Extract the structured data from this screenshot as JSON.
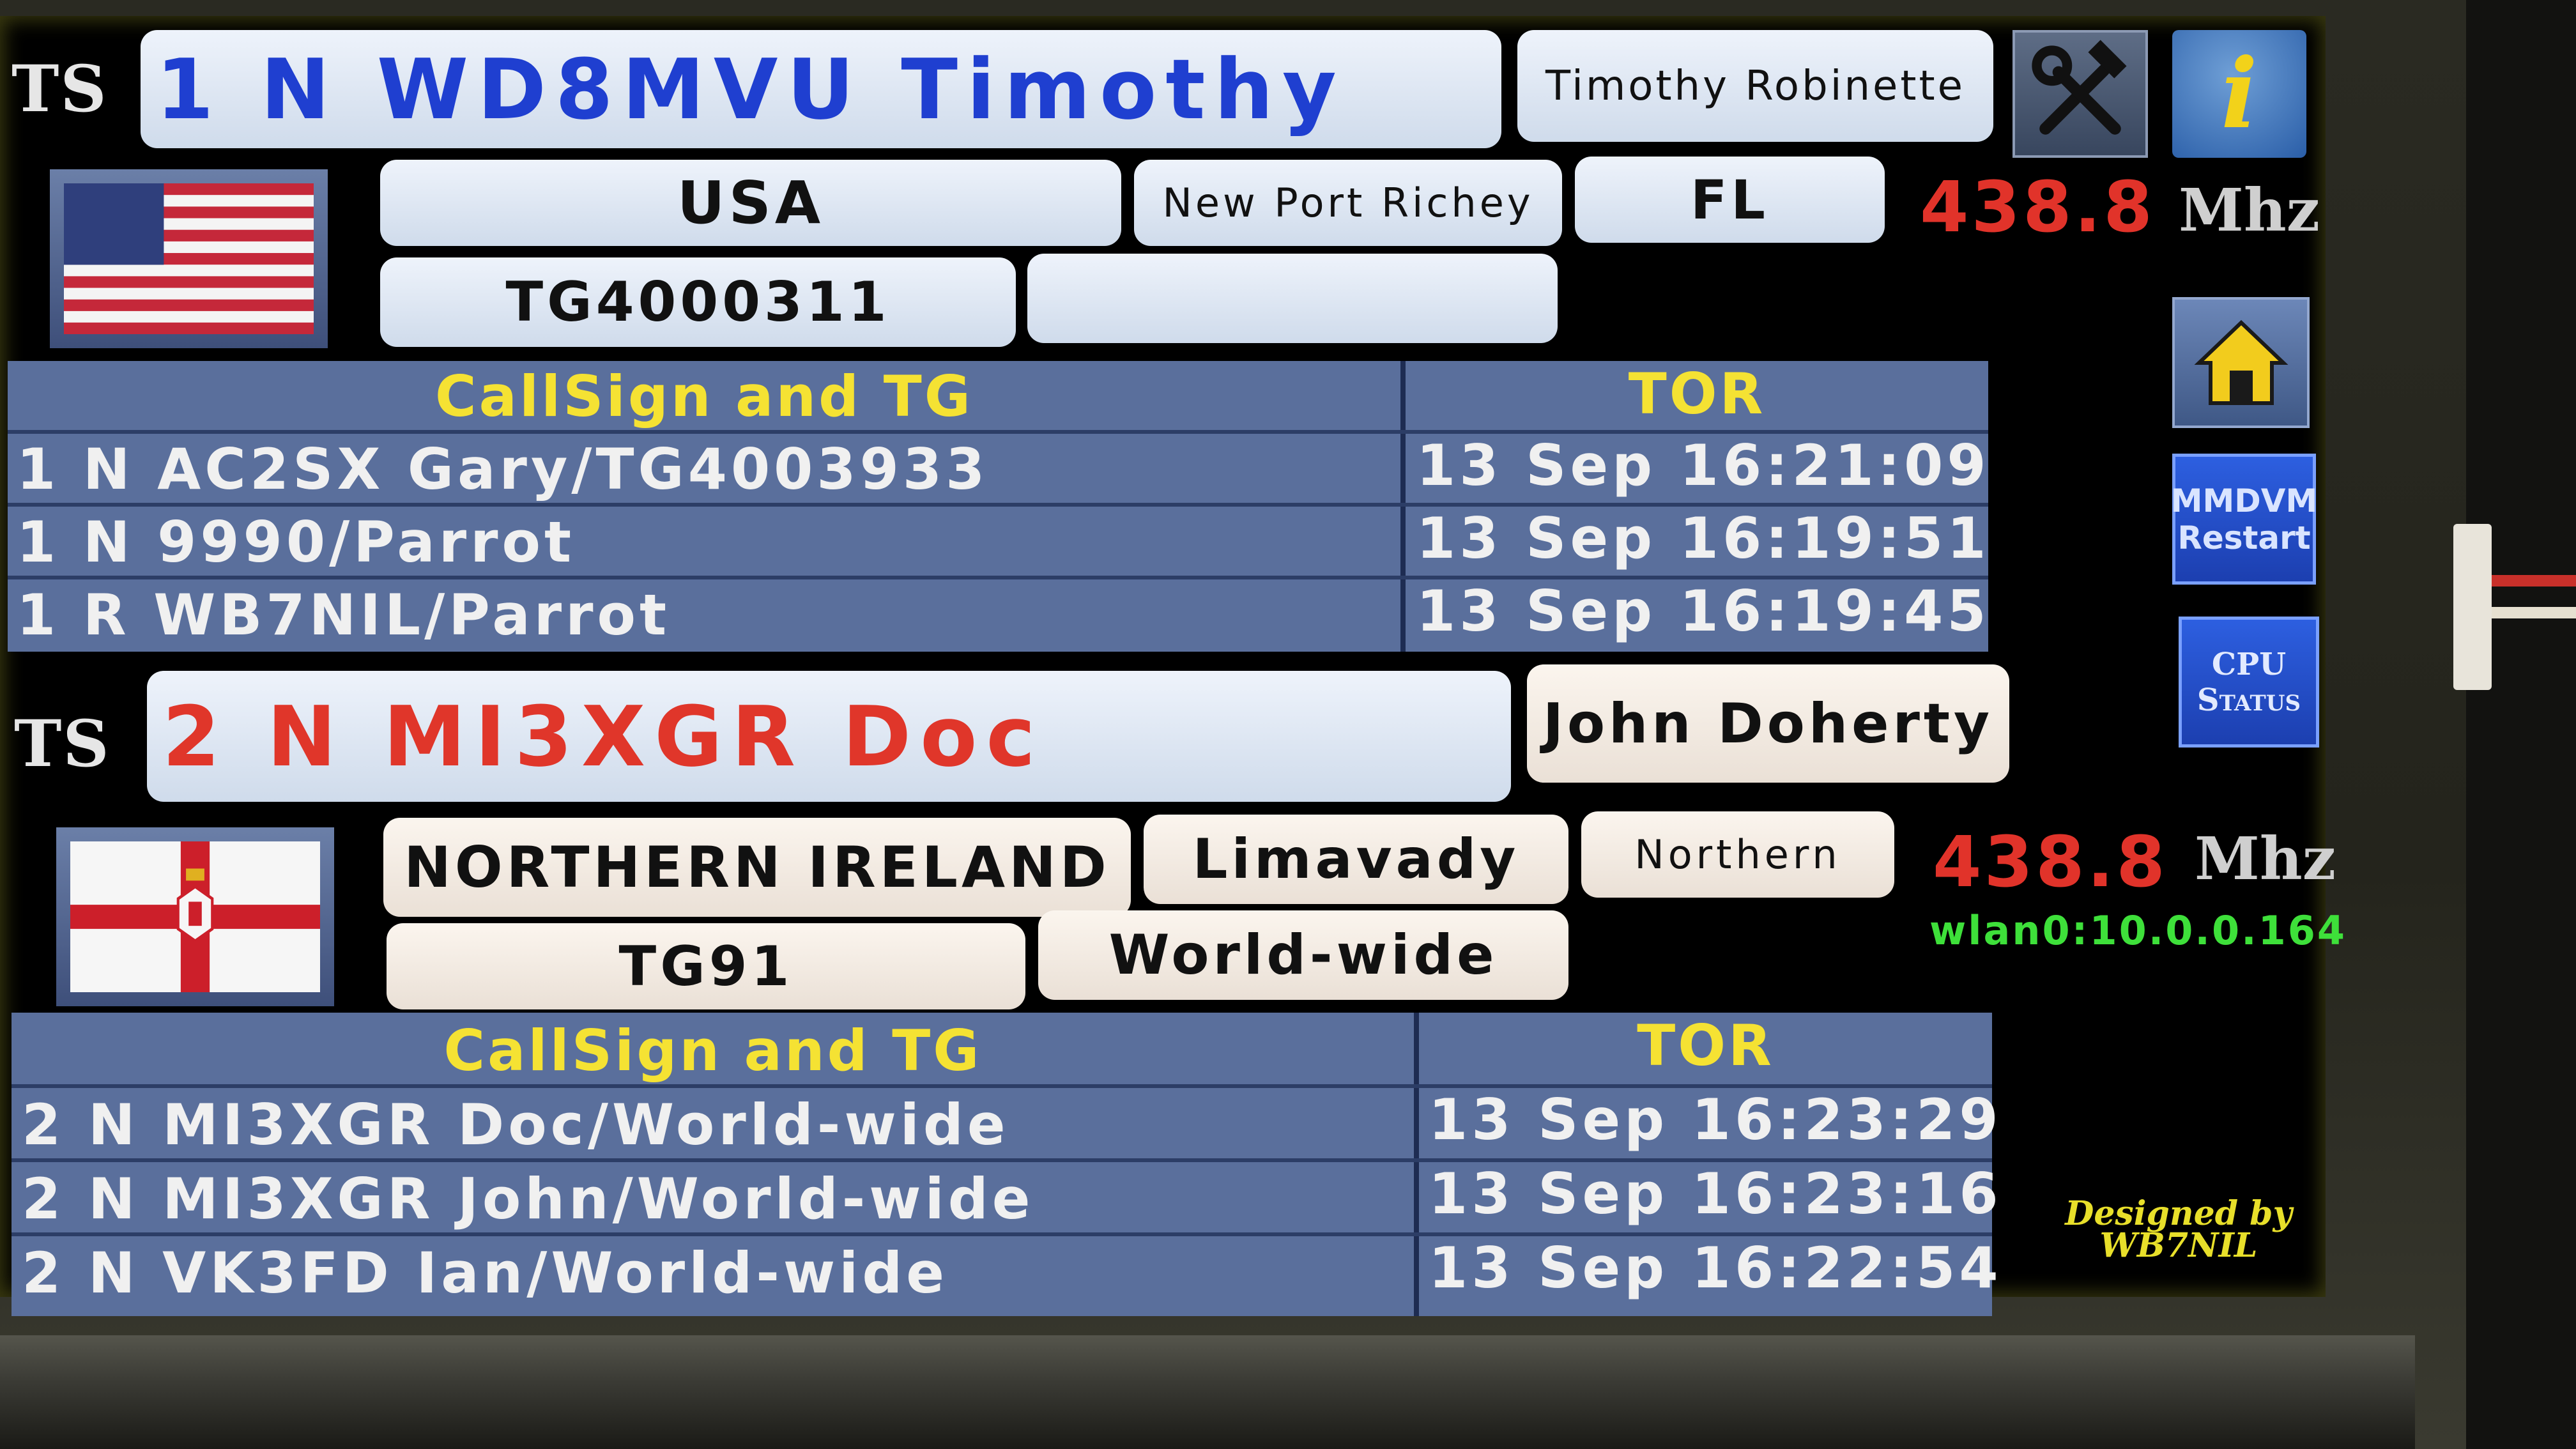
{
  "slot1": {
    "ts": "TS",
    "callsign_line": "1 N WD8MVU Timothy",
    "name": "Timothy Robinette",
    "country": "USA",
    "city": "New Port Richey",
    "state": "FL",
    "talkgroup": "TG4000311",
    "extra": "",
    "frequency": "438.8",
    "unit": "Mhz",
    "accent_color": "#1f3fd0",
    "table": {
      "header_callsign": "CallSign and TG",
      "header_time": "TOR",
      "rows": [
        {
          "callsign": "1 N AC2SX Gary/TG4003933",
          "time": "13 Sep 16:21:09"
        },
        {
          "callsign": "1 N 9990/Parrot",
          "time": "13 Sep 16:19:51"
        },
        {
          "callsign": "1 R WB7NIL/Parrot",
          "time": "13 Sep 16:19:45"
        }
      ]
    }
  },
  "slot2": {
    "ts": "TS",
    "callsign_line": "2 N MI3XGR Doc",
    "name": "John Doherty",
    "country": "NORTHERN IRELAND",
    "city": "Limavady",
    "state": "Northern",
    "talkgroup": "TG91",
    "extra": "World-wide",
    "frequency": "438.8",
    "unit": "Mhz",
    "accent_color": "#e0362a",
    "table": {
      "header_callsign": "CallSign and TG",
      "header_time": "TOR",
      "rows": [
        {
          "callsign": "2 N MI3XGR Doc/World-wide",
          "time": "13 Sep 16:23:29"
        },
        {
          "callsign": "2 N MI3XGR John/World-wide",
          "time": "13 Sep 16:23:16"
        },
        {
          "callsign": "2 N VK3FD Ian/World-wide",
          "time": "13 Sep 16:22:54"
        }
      ]
    }
  },
  "buttons": {
    "tools_icon": "hammer-wrench-icon",
    "info_icon": "info-icon",
    "info_label": "i",
    "home_icon": "home-icon",
    "mmdvm_line1": "MMDVM",
    "mmdvm_line2": "Restart",
    "cpu_line1": "CPU",
    "cpu_line2": "Status"
  },
  "network": "wlan0:10.0.0.164",
  "credit_line1": "Designed by",
  "credit_line2": "WB7NIL",
  "colors": {
    "table_bg": "#5a6f9c",
    "header_text": "#f5e233",
    "frequency": "#e1332a",
    "network_text": "#3ee03a"
  }
}
